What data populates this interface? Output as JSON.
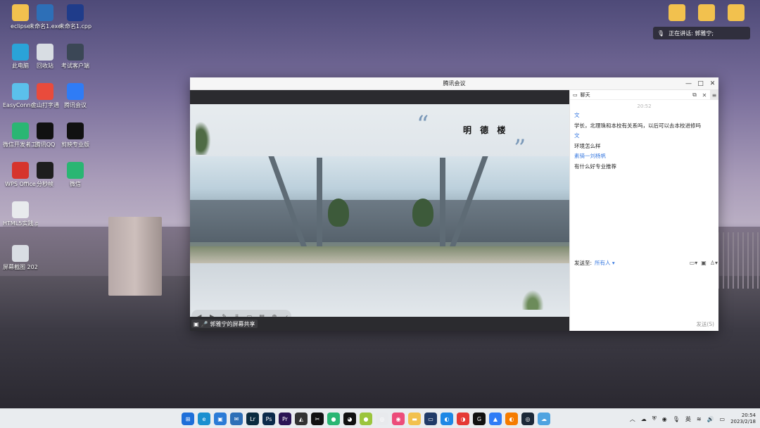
{
  "desktop": {
    "icons": [
      {
        "label": "eclipse",
        "color": "#f2c14e"
      },
      {
        "label": "未命名1.exe",
        "color": "#2d6fb7"
      },
      {
        "label": "未命名1.cpp",
        "color": "#1f3c8a"
      },
      {
        "label": "此电脑",
        "color": "#2aa3d8"
      },
      {
        "label": "回收站",
        "color": "#d8dde3"
      },
      {
        "label": "考试客户端",
        "color": "#3b4756"
      },
      {
        "label": "EasyConne...",
        "color": "#5bc0eb"
      },
      {
        "label": "金山打字通",
        "color": "#e94b3c"
      },
      {
        "label": "腾讯会议",
        "color": "#2f7cf6"
      },
      {
        "label": "微信开发者工具",
        "color": "#2ab673"
      },
      {
        "label": "腾讯QQ",
        "color": "#111111"
      },
      {
        "label": "剪映专业版",
        "color": "#111111"
      },
      {
        "label": "WPS Office",
        "color": "#d6342c"
      },
      {
        "label": "分秒帧",
        "color": "#1e1e1e"
      },
      {
        "label": "微信",
        "color": "#2ab673"
      },
      {
        "label": "HTML5实践.pdf",
        "color": "#e8eaed"
      },
      {
        "label": "屏幕截图 2023-02-1...",
        "color": "#d9dde3"
      }
    ],
    "right_icons": [
      "",
      "",
      ""
    ],
    "notification": {
      "text": "正在讲话: 郭雅宁;"
    }
  },
  "meeting": {
    "title": "腾讯会议",
    "window_controls": [
      "—",
      "□",
      "✕"
    ],
    "slide": {
      "title": "明 德 楼",
      "open_quote": "“",
      "close_quote": "”"
    },
    "toolbar_icons": [
      "◀",
      "▶",
      "✎",
      "⌗",
      "▭",
      "▤",
      "◍",
      "‹"
    ],
    "share_label": "郭雅宁的屏幕共享"
  },
  "chat": {
    "title": "聊天",
    "time": "20:52",
    "messages": [
      {
        "sender": "文",
        "text": "学长，北理珠和本校有关系吗，以后可以去本校进修吗"
      },
      {
        "sender": "文",
        "text": "环境怎么样"
      },
      {
        "sender": "素骑一刘杨帆",
        "text": "有什么好专业推荐"
      }
    ],
    "send_to_label": "发送至:",
    "send_to_value": "所有人 ▾",
    "send_button": "发送(S)"
  },
  "taskbar": {
    "apps": [
      {
        "icon": "windows-icon",
        "color": "#1e6fd9",
        "glyph": "⊞"
      },
      {
        "icon": "edge-icon",
        "color": "#1a8fd0",
        "glyph": "e"
      },
      {
        "icon": "store-icon",
        "color": "#2b7bd6",
        "glyph": "▣"
      },
      {
        "icon": "mail-icon",
        "color": "#2d6fb7",
        "glyph": "✉"
      },
      {
        "icon": "lrc-icon",
        "color": "#0a2b3f",
        "glyph": "Lr"
      },
      {
        "icon": "ps-icon",
        "color": "#0b2a4a",
        "glyph": "Ps"
      },
      {
        "icon": "pr-icon",
        "color": "#2a1454",
        "glyph": "Pr"
      },
      {
        "icon": "app-icon",
        "color": "#333333",
        "glyph": "◭"
      },
      {
        "icon": "capcut-icon",
        "color": "#111111",
        "glyph": "✂"
      },
      {
        "icon": "wechat-icon",
        "color": "#2ab673",
        "glyph": "●"
      },
      {
        "icon": "qq-icon",
        "color": "#111111",
        "glyph": "◕"
      },
      {
        "icon": "app-icon",
        "color": "#9bc53d",
        "glyph": "●"
      },
      {
        "icon": "app-icon",
        "color": "#e8eaed",
        "glyph": "◎"
      },
      {
        "icon": "app-icon",
        "color": "#ec4c7a",
        "glyph": "◉"
      },
      {
        "icon": "explorer-icon",
        "color": "#f2c14e",
        "glyph": "▬"
      },
      {
        "icon": "app-icon",
        "color": "#203a67",
        "glyph": "▭"
      },
      {
        "icon": "app-icon",
        "color": "#1e88e5",
        "glyph": "◐"
      },
      {
        "icon": "app-icon",
        "color": "#e53935",
        "glyph": "◑"
      },
      {
        "icon": "app-icon",
        "color": "#111111",
        "glyph": "G"
      },
      {
        "icon": "meeting-icon",
        "color": "#2f7cf6",
        "glyph": "▲"
      },
      {
        "icon": "app-icon",
        "color": "#f57c00",
        "glyph": "◐"
      },
      {
        "icon": "steam-icon",
        "color": "#1b2838",
        "glyph": "◎"
      },
      {
        "icon": "app-icon",
        "color": "#4fa3e0",
        "glyph": "☁"
      }
    ],
    "tray": {
      "ime": "英",
      "time": "20:54",
      "date": "2023/2/18"
    }
  }
}
